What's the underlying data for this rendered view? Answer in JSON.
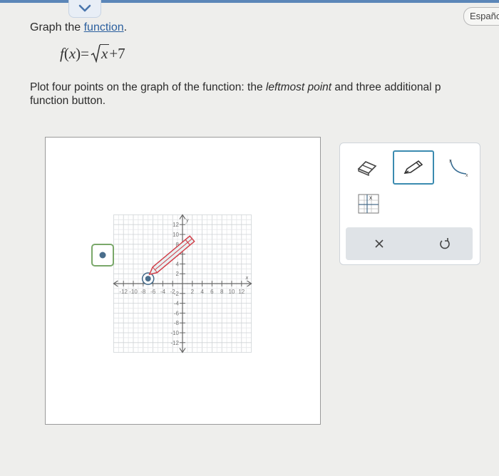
{
  "header": {
    "language_button": "Españo",
    "chevron_icon": "chevron-down-icon"
  },
  "question": {
    "prefix": "Graph the ",
    "link": "function",
    "suffix": ".",
    "formula_f": "f",
    "formula_paren_open": "(",
    "formula_var": "x",
    "formula_paren_close": ")=",
    "formula_radicand": "x",
    "formula_tail": "+7",
    "instruction_part1": "Plot four points on the graph of the function: the ",
    "instruction_em": "leftmost point",
    "instruction_part2": " and three additional p",
    "instruction_line2": "function button."
  },
  "graph": {
    "x_axis_label": "x",
    "y_axis_label": "y",
    "x_min": -14,
    "x_max": 14,
    "y_min": -14,
    "y_max": 14,
    "x_ticks": [
      "-12",
      "-10",
      "-8",
      "-6",
      "-4",
      "-2",
      "2",
      "4",
      "6",
      "8",
      "10",
      "12"
    ],
    "y_ticks": [
      "12",
      "10",
      "8",
      "6",
      "4",
      "2",
      "-2",
      "-4",
      "-6",
      "-8",
      "-10",
      "-12"
    ],
    "placed_point": {
      "x": -7,
      "y": 1
    },
    "accent": "#4a6e8c",
    "pencil_color": "#d0404a"
  },
  "toolbar": {
    "tools": [
      "eraser-icon",
      "pencil-icon",
      "function-curve-icon",
      "function-table-icon"
    ],
    "selected_tool": "pencil-icon",
    "clear_icon": "close-icon",
    "undo_icon": "undo-icon",
    "selected_color": "#3b8bb0"
  }
}
